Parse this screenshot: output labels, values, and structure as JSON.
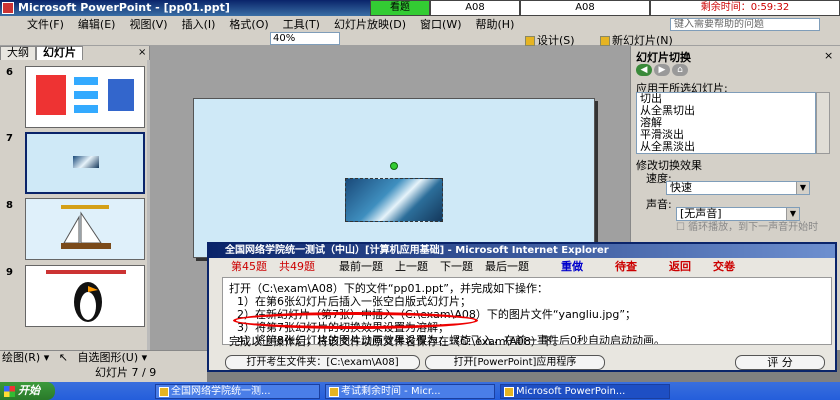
{
  "window": {
    "title": "Microsoft PowerPoint - [pp01.ppt]"
  },
  "timer": {
    "label": "看题",
    "field_a": "A08",
    "field_b": "A08",
    "remaining": "剩余时间：0:59:32"
  },
  "menu": {
    "items": [
      "文件(F)",
      "编辑(E)",
      "视图(V)",
      "插入(I)",
      "格式(O)",
      "工具(T)",
      "幻灯片放映(D)",
      "窗口(W)",
      "帮助(H)"
    ],
    "help_placeholder": "键入需要帮助的问题"
  },
  "toolbar": {
    "zoom": "40%",
    "design_label": "设计(S)",
    "new_slide_label": "新幻灯片(N)"
  },
  "left_panel": {
    "tabs": [
      "大纲",
      "幻灯片"
    ],
    "close": "×",
    "slides": [
      {
        "number": "6"
      },
      {
        "number": "7"
      },
      {
        "number": "8"
      },
      {
        "number": "9"
      }
    ]
  },
  "task_pane": {
    "title": "幻灯片切换",
    "close": "×",
    "apply_label": "应用于所选幻灯片:",
    "transitions": [
      "切出",
      "从全黑切出",
      "溶解",
      "平滑淡出",
      "从全黑淡出"
    ],
    "modify_label": "修改切换效果",
    "speed_label": "速度:",
    "speed_value": "快速",
    "sound_label": "声音:",
    "sound_value": "[无声音]",
    "loop_label": "循环播放，到下一声音开始时"
  },
  "dialog": {
    "title": "全国网络学院统一测试（中山）[计算机应用基础] - Microsoft Internet Explorer",
    "current_label": "第45题",
    "total_label": "共49题",
    "nav": [
      "最前一题",
      "上一题",
      "下一题",
      "最后一题"
    ],
    "redo": "重做",
    "wait": "待查",
    "back": "返回",
    "submit": "交卷",
    "lines": [
      "打开（C:\\exam\\A08）下的文件“pp01.ppt”，并完成如下操作：",
      "1）在第6张幻灯片后插入一张空白版式幻灯片；",
      "2）在新幻灯片（第7张）中插入（C:\\exam\\A08）下的图片文件“yangliu.jpg”；",
      "3）将第7张幻灯片的切换效果设置为溶解；",
      "4）将第8张幻灯片的图片动画效果设置为：螺旋飞入，在前一事件后0秒自动启动动画。",
      "完成以上操作后，将该文件以原文件名保存在（C:\\exam\\A08）下。"
    ],
    "btn_open_folder": "打开考生文件夹：[C:\\exam\\A08]",
    "btn_open_ppt": "打开[PowerPoint]应用程序",
    "btn_grade": "评 分"
  },
  "drawbar": {
    "draw_label": "绘图(R)",
    "autoshape_label": "自选图形(U)"
  },
  "status": {
    "slide_info": "幻灯片 7 / 9"
  },
  "taskbar": {
    "start": "开始",
    "tasks": [
      "全国网络学院统一测...",
      "考试剩余时间 - Micr...",
      "Microsoft PowerPoin..."
    ]
  }
}
